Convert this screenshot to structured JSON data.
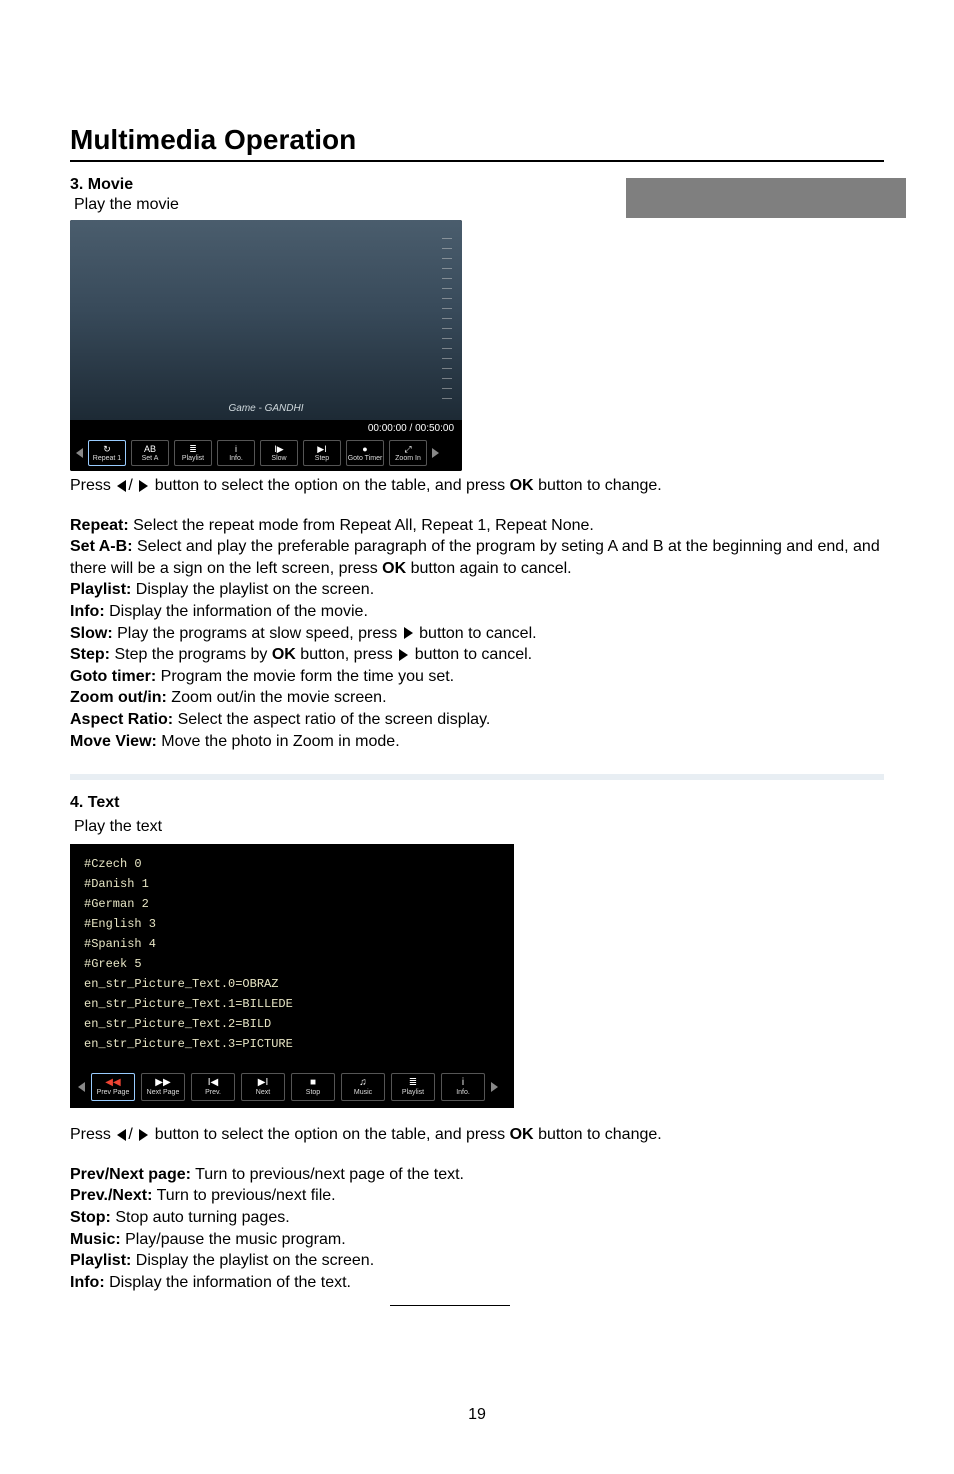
{
  "page": {
    "number": "19"
  },
  "title": "Multimedia Operation",
  "movie": {
    "heading": "3. Movie",
    "subheading": "Play the movie",
    "video_label": "Game - GANDHI",
    "time": "00:00:00 / 00:50:00",
    "toolbar": [
      {
        "label": "Repeat 1",
        "icon": "↻"
      },
      {
        "label": "Set A",
        "icon": "AB"
      },
      {
        "label": "Playlist",
        "icon": "≣"
      },
      {
        "label": "Info.",
        "icon": "i"
      },
      {
        "label": "Slow",
        "icon": "I▶"
      },
      {
        "label": "Step",
        "icon": "▶I"
      },
      {
        "label": "Goto Timer",
        "icon": "●"
      },
      {
        "label": "Zoom In",
        "icon": "⤢"
      }
    ],
    "press_1": "Press ",
    "press_2": " button to select the option on the table, and press ",
    "press_ok": "OK",
    "press_3": " button to change.",
    "items": {
      "repeat_k": "Repeat:",
      "repeat_v": " Select the repeat mode from Repeat All, Repeat 1, Repeat None.",
      "setab_k": "Set A-B:",
      "setab_v": " Select and play the preferable paragraph of the program by seting A and B at the beginning and end, and there will be a sign on the left screen, press ",
      "setab_ok": "OK",
      "setab_v2": " button again to cancel.",
      "playlist_k": "Playlist:",
      "playlist_v": " Display the playlist on the screen.",
      "info_k": "Info:",
      "info_v": " Display the information of the movie.",
      "slow_k": "Slow:",
      "slow_v": " Play the programs at slow speed, press ",
      "slow_v2": " button to cancel.",
      "step_k": "Step:",
      "step_v": " Step the programs by ",
      "step_ok": "OK",
      "step_v2": " button, press ",
      "step_v3": " button to cancel.",
      "goto_k": "Goto timer:",
      "goto_v": " Program the movie form the time you set.",
      "zoom_k": "Zoom out/in:",
      "zoom_v": " Zoom out/in the movie screen.",
      "aspect_k": "Aspect Ratio:",
      "aspect_v": " Select the aspect ratio of the screen display.",
      "move_k": "Move View:",
      "move_v": " Move the photo in Zoom in mode."
    }
  },
  "text": {
    "heading": "4. Text",
    "subheading": "Play the text",
    "lines": [
      "#Czech 0",
      "#Danish 1",
      "#German 2",
      "#English 3",
      "#Spanish 4",
      "#Greek 5",
      "en_str_Picture_Text.0=OBRAZ",
      "en_str_Picture_Text.1=BILLEDE",
      "en_str_Picture_Text.2=BILD",
      "en_str_Picture_Text.3=PICTURE"
    ],
    "toolbar": [
      {
        "label": "Prev Page",
        "icon": "◀◀"
      },
      {
        "label": "Next Page",
        "icon": "▶▶"
      },
      {
        "label": "Prev.",
        "icon": "I◀"
      },
      {
        "label": "Next",
        "icon": "▶I"
      },
      {
        "label": "Stop",
        "icon": "■"
      },
      {
        "label": "Music",
        "icon": "♫"
      },
      {
        "label": "Playlist",
        "icon": "≣"
      },
      {
        "label": "Info.",
        "icon": "i"
      }
    ],
    "press_1": "Press ",
    "press_2": " button to select the option on the table, and press ",
    "press_ok": "OK",
    "press_3": " button to change.",
    "items": {
      "pn_k": "Prev/Next page:",
      "pn_v": " Turn to previous/next page of the text.",
      "pnf_k": "Prev./Next:",
      "pnf_v": " Turn to previous/next file.",
      "stop_k": "Stop:",
      "stop_v": " Stop auto turning pages.",
      "music_k": "Music:",
      "music_v": " Play/pause the music program.",
      "pl_k": "Playlist:",
      "pl_v": " Display the playlist on the screen.",
      "info_k": "Info:",
      "info_v": " Display the information of the text."
    }
  }
}
